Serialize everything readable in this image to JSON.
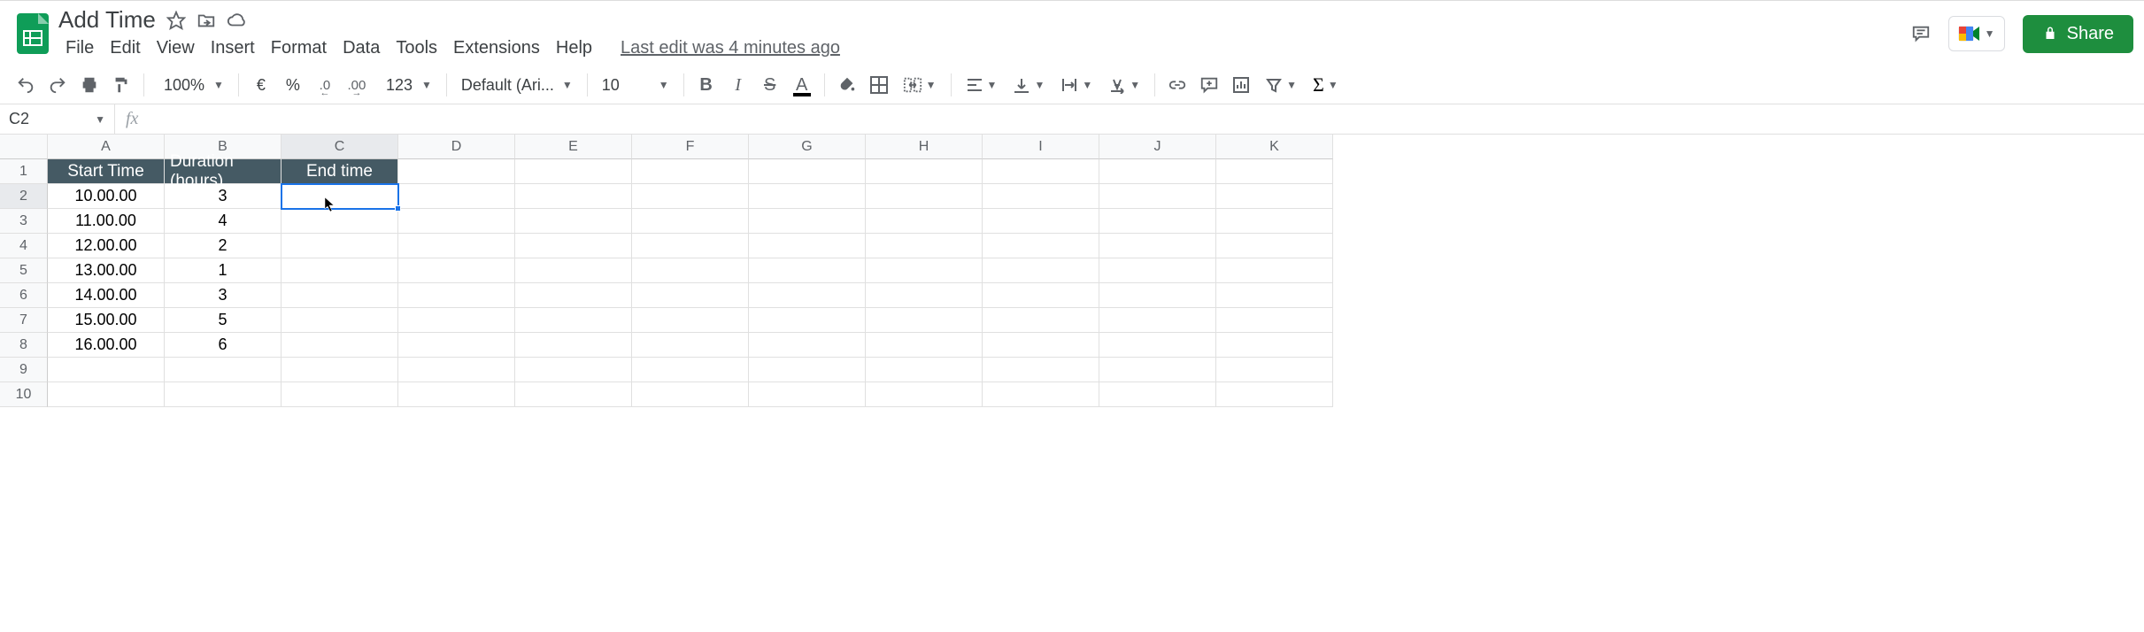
{
  "doc": {
    "title": "Add Time"
  },
  "menubar": {
    "file": "File",
    "edit": "Edit",
    "view": "View",
    "insert": "Insert",
    "format": "Format",
    "data": "Data",
    "tools": "Tools",
    "extensions": "Extensions",
    "help": "Help",
    "last_edit": "Last edit was 4 minutes ago"
  },
  "share": {
    "label": "Share"
  },
  "toolbar": {
    "zoom": "100%",
    "currency": "€",
    "percent": "%",
    "dec_dec": ".0",
    "dec_inc": ".00",
    "more_formats": "123",
    "font_name": "Default (Ari...",
    "font_size": "10"
  },
  "namebox": {
    "value": "C2"
  },
  "formula": {
    "value": ""
  },
  "columns": [
    "A",
    "B",
    "C",
    "D",
    "E",
    "F",
    "G",
    "H",
    "I",
    "J",
    "K"
  ],
  "rows": [
    "1",
    "2",
    "3",
    "4",
    "5",
    "6",
    "7",
    "8",
    "9",
    "10"
  ],
  "selected_col": "C",
  "selected_row": "2",
  "headers": {
    "a": "Start Time",
    "b": "Duration (hours)",
    "c": "End time"
  },
  "data_rows": [
    {
      "start": "10.00.00",
      "dur": "3",
      "end": ""
    },
    {
      "start": "11.00.00",
      "dur": "4",
      "end": ""
    },
    {
      "start": "12.00.00",
      "dur": "2",
      "end": ""
    },
    {
      "start": "13.00.00",
      "dur": "1",
      "end": ""
    },
    {
      "start": "14.00.00",
      "dur": "3",
      "end": ""
    },
    {
      "start": "15.00.00",
      "dur": "5",
      "end": ""
    },
    {
      "start": "16.00.00",
      "dur": "6",
      "end": ""
    }
  ],
  "chart_data": {
    "type": "table",
    "columns": [
      "Start Time",
      "Duration (hours)",
      "End time"
    ],
    "rows": [
      [
        "10.00.00",
        3,
        null
      ],
      [
        "11.00.00",
        4,
        null
      ],
      [
        "12.00.00",
        2,
        null
      ],
      [
        "13.00.00",
        1,
        null
      ],
      [
        "14.00.00",
        3,
        null
      ],
      [
        "15.00.00",
        5,
        null
      ],
      [
        "16.00.00",
        6,
        null
      ]
    ]
  }
}
